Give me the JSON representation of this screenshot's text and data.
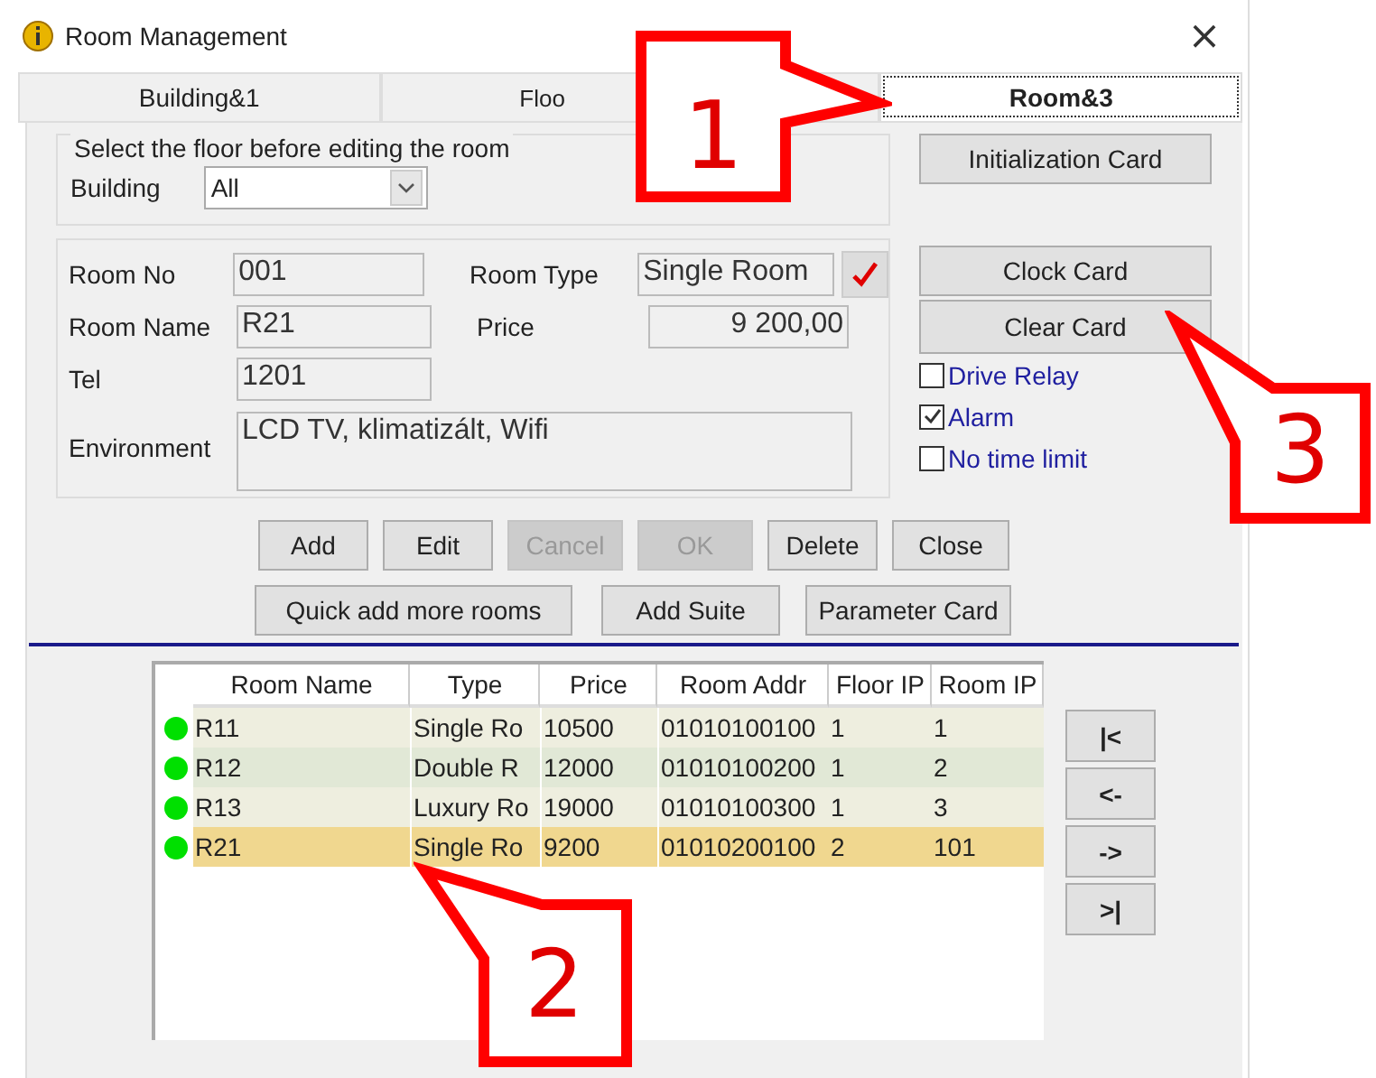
{
  "window": {
    "title": "Room Management",
    "close": "×"
  },
  "tabs": [
    {
      "label": "Building&1",
      "selected": false
    },
    {
      "label": "Floo",
      "selected": false
    },
    {
      "label": "Room&3",
      "selected": true
    }
  ],
  "floor_group": {
    "legend": "Select the floor before editing the room",
    "label": "Building",
    "value": "All"
  },
  "room_no": {
    "label": "Room No",
    "value": "001"
  },
  "room_name": {
    "label": "Room Name",
    "value": "R21"
  },
  "tel": {
    "label": "Tel",
    "value": "1201"
  },
  "room_type": {
    "label": "Room Type",
    "value": "Single Room"
  },
  "price": {
    "label": "Price",
    "value": "9 200,00"
  },
  "environment": {
    "label": "Environment",
    "value": "LCD TV, klimatizált, Wifi"
  },
  "card_buttons": [
    "Initialization Card",
    "Clock Card",
    "Clear Card"
  ],
  "options": [
    {
      "label": "Drive Relay",
      "checked": false
    },
    {
      "label": "Alarm",
      "checked": true
    },
    {
      "label": "No time limit",
      "checked": false
    }
  ],
  "actions": [
    {
      "label": "Add",
      "disabled": false
    },
    {
      "label": "Edit",
      "disabled": false
    },
    {
      "label": "Cancel",
      "disabled": true
    },
    {
      "label": "OK",
      "disabled": true
    },
    {
      "label": "Delete",
      "disabled": false
    },
    {
      "label": "Close",
      "disabled": false
    }
  ],
  "extra_actions": [
    "Quick add more rooms",
    "Add Suite",
    "Parameter Card"
  ],
  "table": {
    "columns": [
      "Room Name",
      "Type",
      "Price",
      "Room Addr",
      "Floor IP",
      "Room IP"
    ],
    "rows": [
      {
        "color": "#00e000",
        "selected": false,
        "cells": [
          "R11",
          "Single Ro",
          "10500",
          "01010100100",
          "1",
          "1"
        ]
      },
      {
        "color": "#00e000",
        "selected": false,
        "cells": [
          "R12",
          "Double R",
          "12000",
          "01010100200",
          "1",
          "2"
        ]
      },
      {
        "color": "#00e000",
        "selected": false,
        "cells": [
          "R13",
          "Luxury Ro",
          "19000",
          "01010100300",
          "1",
          "3"
        ]
      },
      {
        "color": "#00e000",
        "selected": true,
        "cells": [
          "R21",
          "Single Ro",
          "9200",
          "01010200100",
          "2",
          "101"
        ]
      }
    ]
  },
  "nav_buttons": [
    "|<",
    "<-",
    "->",
    ">|"
  ],
  "callouts": [
    "1",
    "2",
    "3"
  ]
}
